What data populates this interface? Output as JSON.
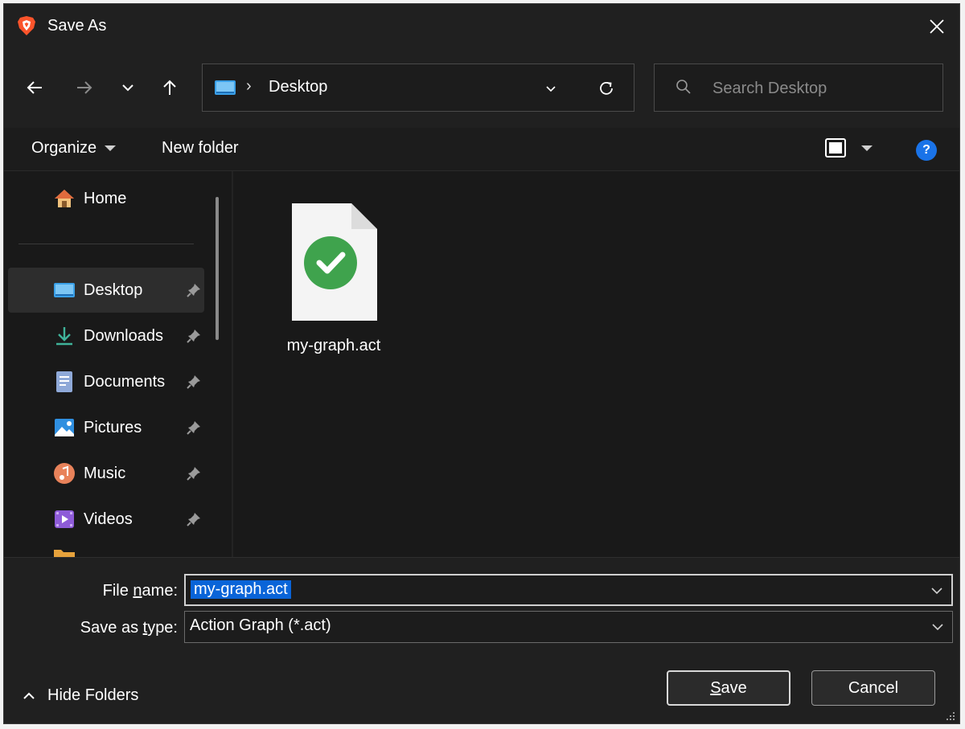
{
  "window": {
    "title": "Save As"
  },
  "nav": {
    "address_separator": "›",
    "address_location": "Desktop",
    "search_placeholder": "Search Desktop"
  },
  "commands": {
    "organize_label": "Organize",
    "new_folder_label": "New folder",
    "help_label": "?"
  },
  "sidebar": {
    "items": [
      {
        "label": "Home",
        "icon": "home-icon",
        "pinned": false
      },
      {
        "label": "Desktop",
        "icon": "desktop-icon",
        "pinned": true,
        "active": true
      },
      {
        "label": "Downloads",
        "icon": "download-icon",
        "pinned": true
      },
      {
        "label": "Documents",
        "icon": "documents-icon",
        "pinned": true
      },
      {
        "label": "Pictures",
        "icon": "pictures-icon",
        "pinned": true
      },
      {
        "label": "Music",
        "icon": "music-icon",
        "pinned": true
      },
      {
        "label": "Videos",
        "icon": "videos-icon",
        "pinned": true
      }
    ]
  },
  "files": [
    {
      "name": "my-graph.act",
      "icon": "file-check-icon"
    }
  ],
  "form": {
    "file_name_label_pre": "File ",
    "file_name_label_mnemonic": "n",
    "file_name_label_post": "ame:",
    "file_name_value": "my-graph.act",
    "save_type_label_pre": "Save as ",
    "save_type_label_mnemonic": "t",
    "save_type_label_post": "ype:",
    "save_type_value": "Action Graph (*.act)"
  },
  "footer": {
    "hide_folders_label": "Hide Folders",
    "save_label_mnemonic": "S",
    "save_label_rest": "ave",
    "cancel_label": "Cancel"
  },
  "colors": {
    "window_bg": "#191919",
    "chrome_bg": "#202020",
    "selection": "#0a64d8",
    "help_blue": "#1a73e8",
    "check_green": "#3fa34d"
  }
}
